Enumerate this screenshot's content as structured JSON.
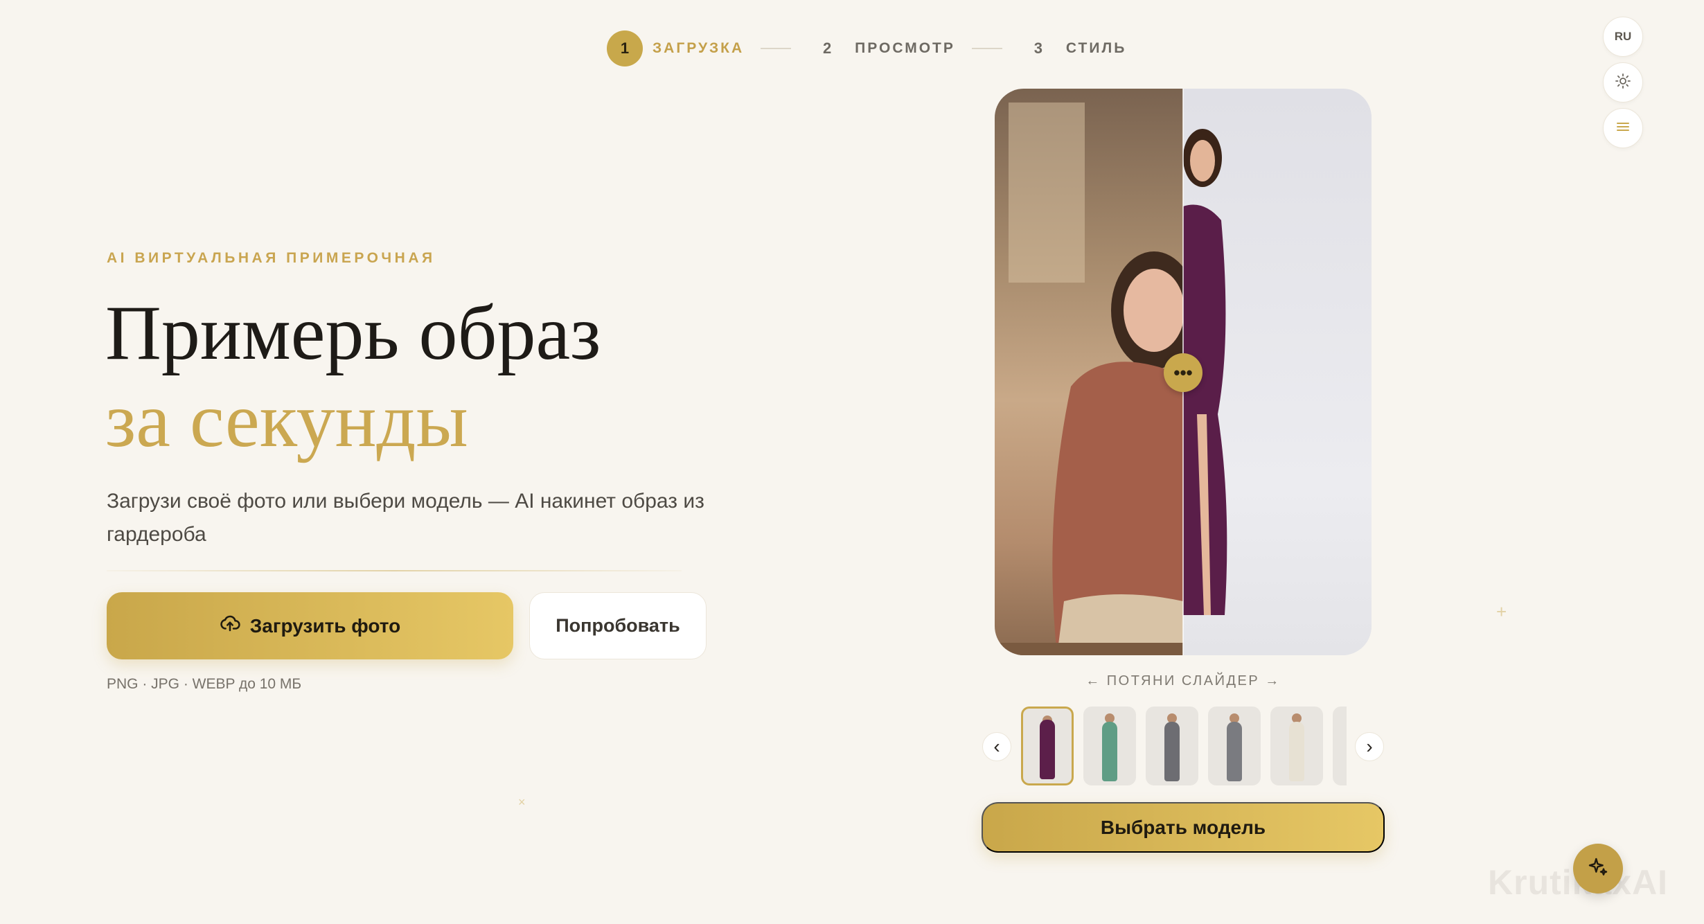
{
  "stepper": {
    "steps": [
      {
        "num": "1",
        "label": "ЗАГРУЗКА"
      },
      {
        "num": "2",
        "label": "ПРОСМОТР"
      },
      {
        "num": "3",
        "label": "СТИЛЬ"
      }
    ],
    "active_step": 1
  },
  "top_controls": {
    "language": "RU",
    "theme_icon": "sun-icon",
    "menu_icon": "menu-icon"
  },
  "hero": {
    "eyebrow": "AI ВИРТУАЛЬНАЯ ПРИМЕРОЧНАЯ",
    "title_line1": "Примерь образ",
    "title_line2": "за секунды",
    "description": "Загрузи своё фото или выбери модель — AI накинет образ из гардероба",
    "upload_button": "Загрузить фото",
    "try_button": "Попробовать",
    "formats": "PNG · JPG · WEBP до 10 МБ"
  },
  "preview": {
    "slider_handle": "•••",
    "slider_hint": "← ПОТЯНИ СЛАЙДЕР →",
    "prev_arrow": "‹",
    "next_arrow": "›",
    "thumbnails": [
      {
        "name": "model-purple-dress",
        "color": "#5c1f4a",
        "selected": true
      },
      {
        "name": "model-green-dress",
        "color": "#5f9d85",
        "selected": false
      },
      {
        "name": "model-grey-suit",
        "color": "#6d6d72",
        "selected": false
      },
      {
        "name": "model-grey-suit-2",
        "color": "#7a7b80",
        "selected": false
      },
      {
        "name": "model-white-outfit",
        "color": "#e7e1d3",
        "selected": false
      },
      {
        "name": "model-partial",
        "color": "#d8d4cc",
        "selected": false
      }
    ],
    "choose_button": "Выбрать модель"
  },
  "assistant": {
    "icon": "sparkles-icon"
  },
  "watermark": "KrutikaxAI",
  "colors": {
    "accent": "#c9a84d",
    "background": "#f8f5ef"
  }
}
